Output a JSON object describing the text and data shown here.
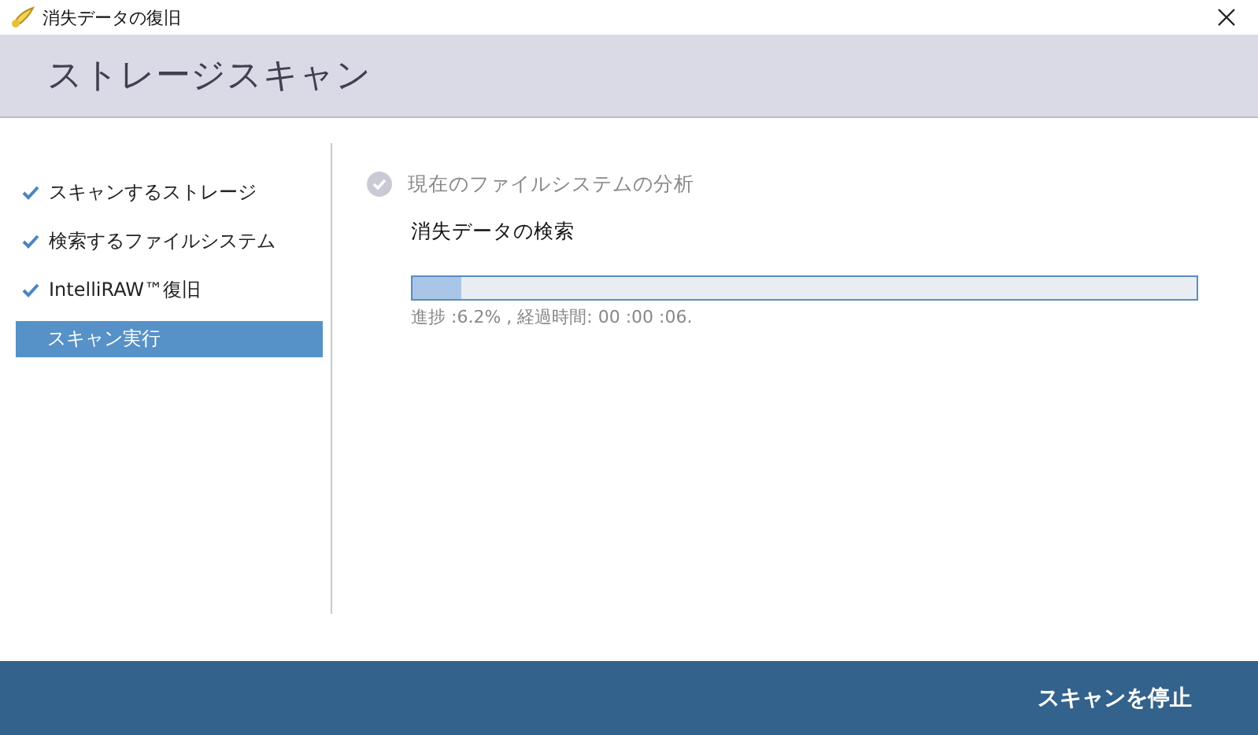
{
  "window": {
    "title": "消失データの復旧"
  },
  "header": {
    "title": "ストレージスキャン"
  },
  "steps": [
    {
      "label": "スキャンするストレージ",
      "done": true,
      "selected": false
    },
    {
      "label": "検索するファイルシステム",
      "done": true,
      "selected": false
    },
    {
      "label": "IntelliRAW™復旧",
      "done": true,
      "selected": false
    },
    {
      "label": "スキャン実行",
      "done": false,
      "selected": true
    }
  ],
  "stages": [
    {
      "label": "現在のファイルシステムの分析",
      "done": true
    },
    {
      "label": "消失データの検索",
      "done": false
    }
  ],
  "progress": {
    "level": 0.062,
    "status": "進捗 :6.2% , 経過時間: 00 :00 :06."
  },
  "footer": {
    "button": "スキャンを停止"
  }
}
